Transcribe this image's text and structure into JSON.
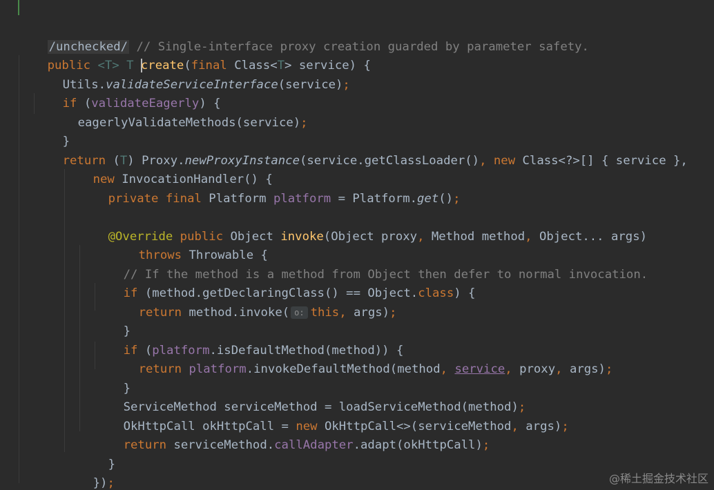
{
  "editor": {
    "hint": "o:",
    "watermark": "@稀土掘金技术社区",
    "colors": {
      "background": "#2b2b2b",
      "keyword": "#cc7832",
      "annotation": "#bbb529",
      "comment": "#808080",
      "method_decl": "#ffc66d",
      "field": "#9876aa",
      "type_param": "#507874",
      "text": "#a9b7c6"
    }
  },
  "code": {
    "l1": {
      "a": "/unchecked/",
      "b": " // Single-interface proxy creation guarded by parameter safety."
    },
    "l2": {
      "a": "public ",
      "b": "<T>",
      "c": " T ",
      "d": "create",
      "e": "(",
      "f": "final ",
      "g": "Class<",
      "h": "T",
      "i": "> service) {"
    },
    "l3": {
      "a": "Utils.",
      "b": "validateServiceInterface",
      "c": "(service)",
      "d": ";"
    },
    "l4": {
      "a": "if ",
      "b": "(",
      "c": "validateEagerly",
      "d": ") {"
    },
    "l5": {
      "a": "eagerlyValidateMethods(service)",
      "b": ";"
    },
    "l6": {
      "a": "}"
    },
    "l7": {
      "a": "return ",
      "b": "(",
      "c": "T",
      "d": ") Proxy.",
      "e": "newProxyInstance",
      "f": "(service.getClassLoader()",
      "g": ", ",
      "h": "new ",
      "i": "Class<?>[] { service },",
      "j": ""
    },
    "l8": {
      "a": "new ",
      "b": "InvocationHandler() {"
    },
    "l9": {
      "a": "private final ",
      "b": "Platform ",
      "c": "platform",
      "d": " = Platform.",
      "e": "get",
      "f": "()",
      "g": ";"
    },
    "l10": {
      "a": "@Override ",
      "b": "public ",
      "c": "Object ",
      "d": "invoke",
      "e": "(Object proxy",
      "f": ", ",
      "g": "Method method",
      "h": ", ",
      "i": "Object... args)"
    },
    "l11": {
      "a": "throws ",
      "b": "Throwable {"
    },
    "l12": {
      "a": "// If the method is a method from Object then defer to normal invocation."
    },
    "l13": {
      "a": "if ",
      "b": "(method.getDeclaringClass() == Object.",
      "c": "class",
      "d": ") {"
    },
    "l14": {
      "a": "return ",
      "b": "method.invoke(",
      "c": "this",
      "d": ", ",
      "e": "args)",
      "f": ";"
    },
    "l15": {
      "a": "}"
    },
    "l16": {
      "a": "if ",
      "b": "(",
      "c": "platform",
      "d": ".isDefaultMethod(method)) {"
    },
    "l17": {
      "a": "return ",
      "b": "platform",
      "c": ".invokeDefaultMethod(method",
      "d": ", ",
      "e": "service",
      "f": ", ",
      "g": "proxy",
      "h": ", ",
      "i": "args)",
      "j": ";"
    },
    "l18": {
      "a": "}"
    },
    "l19": {
      "a": "ServiceMethod serviceMethod = loadServiceMethod(method)",
      "b": ";"
    },
    "l20": {
      "a": "OkHttpCall okHttpCall = ",
      "b": "new ",
      "c": "OkHttpCall<>(serviceMethod",
      "d": ", ",
      "e": "args)",
      "f": ";"
    },
    "l21": {
      "a": "return ",
      "b": "serviceMethod.",
      "c": "callAdapter",
      "d": ".adapt(okHttpCall)",
      "e": ";"
    },
    "l22": {
      "a": "}"
    },
    "l23": {
      "a": "})",
      "b": ";"
    },
    "l24": {
      "a": "}"
    }
  }
}
